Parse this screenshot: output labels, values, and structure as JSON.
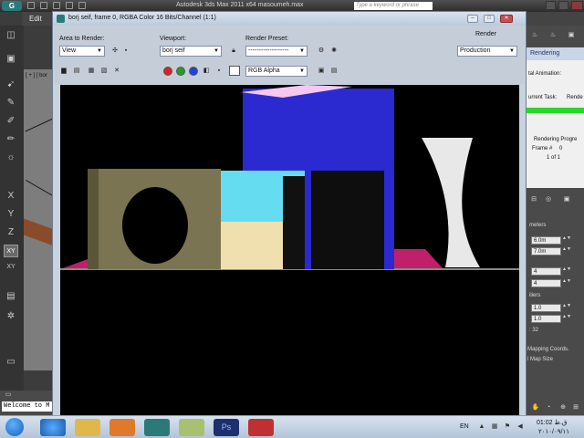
{
  "max_app": {
    "title": "Autodesk 3ds Max  2011 x64     masoumeh.max",
    "search_placeholder": "Type a keyword or phrase",
    "menu_first_item": "Edit",
    "viewport_label": "[ + ] [ bor",
    "listener_text": "Welcome to M",
    "logo_glyph": "G"
  },
  "render_window": {
    "title": "borj seif, frame 0, RGBA Color 16 Bits/Channel (1:1)",
    "area_to_render_label": "Area to Render:",
    "area_to_render_value": "View",
    "viewport_label": "Viewport:",
    "viewport_value": "borj seif",
    "render_preset_label": "Render Preset:",
    "render_preset_value": "-------------------",
    "render_label": "Render",
    "production_value": "Production",
    "channel_value": "RGB Alpha",
    "channel_dots": [
      "#e02020",
      "#20a020",
      "#2040e0"
    ]
  },
  "rendering_panel": {
    "title": "Rendering",
    "animation_label": "tal Animation:",
    "current_task_label": "urrent Task:",
    "current_task_value": "Rende",
    "progress_label": "Rendering Progre",
    "frame_label": "Frame #",
    "frame_value": "0",
    "frame_count": "1 of 1",
    "parameters_label": "meters",
    "spinner_1": "6.0m",
    "spinner_2": "7.0m",
    "spinner_3": "4",
    "spinner_4": "4",
    "multipliers_label": "iliers",
    "spinner_5": "1.0",
    "spinner_6": "1.0",
    "segments_value": ": 32",
    "mapping_label": "Mapping Coords.",
    "map_size_label": "l Map Size"
  },
  "tray": {
    "language": "EN",
    "time": "01:02 ق.ظ",
    "date": "۲۰۱۰/۰۹/۱۱"
  },
  "colors": {
    "scene_wall_purple": "#2a2ad0",
    "scene_wall_pink": "#f6c8f0",
    "scene_wall_olive": "#7a7452",
    "scene_wall_cyan": "#66dcf0",
    "scene_floor_magenta": "#c0206a",
    "scene_vase": "#e8e8e8"
  }
}
